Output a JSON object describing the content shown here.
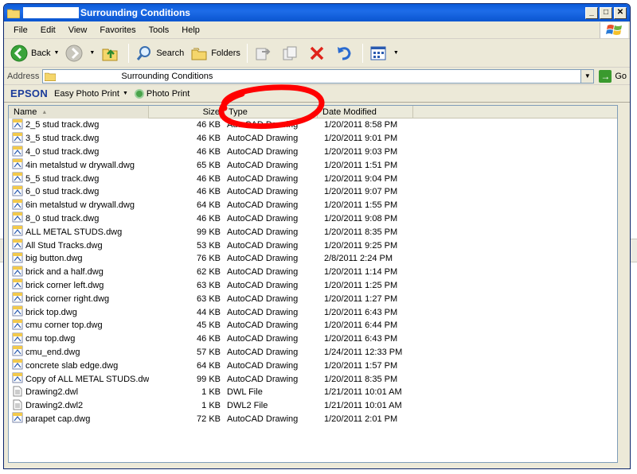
{
  "window": {
    "title": "Surrounding Conditions"
  },
  "menu": [
    "File",
    "Edit",
    "View",
    "Favorites",
    "Tools",
    "Help"
  ],
  "toolbar": {
    "back_label": "Back",
    "search_label": "Search",
    "folders_label": "Folders"
  },
  "address": {
    "label": "Address",
    "value": "Surrounding Conditions",
    "go_label": "Go"
  },
  "epson": {
    "logo": "EPSON",
    "easy_photo_print": "Easy Photo Print",
    "photo_print": "Photo Print"
  },
  "columns": {
    "name": "Name",
    "size": "Size",
    "type": "Type",
    "date": "Date Modified"
  },
  "files": [
    {
      "name": "2_5 stud track.dwg",
      "size": "46 KB",
      "type": "AutoCAD Drawing",
      "date": "1/20/2011 8:58 PM",
      "icon": "dwg-file-icon"
    },
    {
      "name": "3_5 stud track.dwg",
      "size": "46 KB",
      "type": "AutoCAD Drawing",
      "date": "1/20/2011 9:01 PM",
      "icon": "dwg-file-icon"
    },
    {
      "name": "4_0 stud track.dwg",
      "size": "46 KB",
      "type": "AutoCAD Drawing",
      "date": "1/20/2011 9:03 PM",
      "icon": "dwg-file-icon"
    },
    {
      "name": "4in metalstud w drywall.dwg",
      "size": "65 KB",
      "type": "AutoCAD Drawing",
      "date": "1/20/2011 1:51 PM",
      "icon": "dwg-file-icon"
    },
    {
      "name": "5_5 stud track.dwg",
      "size": "46 KB",
      "type": "AutoCAD Drawing",
      "date": "1/20/2011 9:04 PM",
      "icon": "dwg-file-icon"
    },
    {
      "name": "6_0 stud track.dwg",
      "size": "46 KB",
      "type": "AutoCAD Drawing",
      "date": "1/20/2011 9:07 PM",
      "icon": "dwg-file-icon"
    },
    {
      "name": "6in metalstud w drywall.dwg",
      "size": "64 KB",
      "type": "AutoCAD Drawing",
      "date": "1/20/2011 1:55 PM",
      "icon": "dwg-file-icon"
    },
    {
      "name": "8_0 stud track.dwg",
      "size": "46 KB",
      "type": "AutoCAD Drawing",
      "date": "1/20/2011 9:08 PM",
      "icon": "dwg-file-icon"
    },
    {
      "name": "ALL METAL STUDS.dwg",
      "size": "99 KB",
      "type": "AutoCAD Drawing",
      "date": "1/20/2011 8:35 PM",
      "icon": "dwg-file-icon"
    },
    {
      "name": "All Stud Tracks.dwg",
      "size": "53 KB",
      "type": "AutoCAD Drawing",
      "date": "1/20/2011 9:25 PM",
      "icon": "dwg-file-icon"
    },
    {
      "name": "big button.dwg",
      "size": "76 KB",
      "type": "AutoCAD Drawing",
      "date": "2/8/2011 2:24 PM",
      "icon": "dwg-file-icon"
    },
    {
      "name": "brick and a half.dwg",
      "size": "62 KB",
      "type": "AutoCAD Drawing",
      "date": "1/20/2011 1:14 PM",
      "icon": "dwg-file-icon"
    },
    {
      "name": "brick corner left.dwg",
      "size": "63 KB",
      "type": "AutoCAD Drawing",
      "date": "1/20/2011 1:25 PM",
      "icon": "dwg-file-icon"
    },
    {
      "name": "brick corner right.dwg",
      "size": "63 KB",
      "type": "AutoCAD Drawing",
      "date": "1/20/2011 1:27 PM",
      "icon": "dwg-file-icon"
    },
    {
      "name": "brick top.dwg",
      "size": "44 KB",
      "type": "AutoCAD Drawing",
      "date": "1/20/2011 6:43 PM",
      "icon": "dwg-file-icon"
    },
    {
      "name": "cmu corner top.dwg",
      "size": "45 KB",
      "type": "AutoCAD Drawing",
      "date": "1/20/2011 6:44 PM",
      "icon": "dwg-file-icon"
    },
    {
      "name": "cmu top.dwg",
      "size": "46 KB",
      "type": "AutoCAD Drawing",
      "date": "1/20/2011 6:43 PM",
      "icon": "dwg-file-icon"
    },
    {
      "name": "cmu_end.dwg",
      "size": "57 KB",
      "type": "AutoCAD Drawing",
      "date": "1/24/2011 12:33 PM",
      "icon": "dwg-file-icon"
    },
    {
      "name": "concrete slab edge.dwg",
      "size": "64 KB",
      "type": "AutoCAD Drawing",
      "date": "1/20/2011 1:57 PM",
      "icon": "dwg-file-icon"
    },
    {
      "name": "Copy of ALL METAL STUDS.dwg",
      "size": "99 KB",
      "type": "AutoCAD Drawing",
      "date": "1/20/2011 8:35 PM",
      "icon": "dwg-file-icon"
    },
    {
      "name": "Drawing2.dwl",
      "size": "1 KB",
      "type": "DWL File",
      "date": "1/21/2011 10:01 AM",
      "icon": "text-file-icon"
    },
    {
      "name": "Drawing2.dwl2",
      "size": "1 KB",
      "type": "DWL2 File",
      "date": "1/21/2011 10:01 AM",
      "icon": "text-file-icon"
    },
    {
      "name": "parapet cap.dwg",
      "size": "72 KB",
      "type": "AutoCAD Drawing",
      "date": "1/20/2011 2:01 PM",
      "icon": "dwg-file-icon"
    }
  ],
  "colors": {
    "titlebar": "#0a5ad8",
    "annotation": "#ff0000"
  }
}
